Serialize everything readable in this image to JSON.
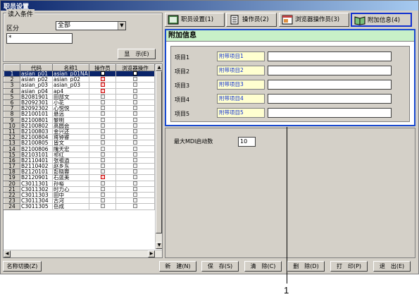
{
  "window": {
    "title": "职员设置"
  },
  "filter": {
    "legend": "读入条件",
    "kubun_label": "区分",
    "kubun_value": "全部",
    "search_value": "*",
    "display_button": "显　示(E)"
  },
  "grid": {
    "headers": [
      "代码",
      "名称1",
      "操作员",
      "浏览器操作"
    ],
    "rows": [
      {
        "n": "1",
        "code": "asian_p01",
        "name": "asian_p01NA",
        "op": "on",
        "br": "on"
      },
      {
        "n": "2",
        "code": "asian_p02",
        "name": "asian_p02",
        "op": "red",
        "br": "off"
      },
      {
        "n": "3",
        "code": "asian_p03",
        "name": "asian_p03",
        "op": "red",
        "br": "off"
      },
      {
        "n": "4",
        "code": "asian_p04",
        "name": "ap4",
        "op": "red",
        "br": "off"
      },
      {
        "n": "5",
        "code": "B2081901",
        "name": "田部文",
        "op": "off",
        "br": "off"
      },
      {
        "n": "6",
        "code": "B2092301",
        "name": "小花",
        "op": "off",
        "br": "off"
      },
      {
        "n": "7",
        "code": "B2092302",
        "name": "心悦悦",
        "op": "off",
        "br": "off"
      },
      {
        "n": "8",
        "code": "B2100101",
        "name": "悬远",
        "op": "off",
        "br": "off"
      },
      {
        "n": "9",
        "code": "B2100801",
        "name": "黎明",
        "op": "off",
        "br": "off"
      },
      {
        "n": "10",
        "code": "B2100802",
        "name": "高圆会",
        "op": "off",
        "br": "off"
      },
      {
        "n": "11",
        "code": "B2100803",
        "name": "金兴还",
        "op": "off",
        "br": "off"
      },
      {
        "n": "12",
        "code": "B2100804",
        "name": "蒋钟睿",
        "op": "off",
        "br": "off"
      },
      {
        "n": "13",
        "code": "B2100805",
        "name": "皆文",
        "op": "off",
        "br": "off"
      },
      {
        "n": "14",
        "code": "B2100806",
        "name": "隗天宏",
        "op": "off",
        "br": "off"
      },
      {
        "n": "15",
        "code": "B2103101",
        "name": "祁红",
        "op": "off",
        "br": "off"
      },
      {
        "n": "16",
        "code": "B2110401",
        "name": "张祖逍",
        "op": "off",
        "br": "off"
      },
      {
        "n": "17",
        "code": "B2110402",
        "name": "赵乡东",
        "op": "off",
        "br": "off"
      },
      {
        "n": "18",
        "code": "B2120101",
        "name": "彭晓蓉",
        "op": "off",
        "br": "off"
      },
      {
        "n": "19",
        "code": "B2120901",
        "name": "石蓝美",
        "op": "red",
        "br": "off"
      },
      {
        "n": "20",
        "code": "C3011301",
        "name": "孙裕",
        "op": "off",
        "br": "off"
      },
      {
        "n": "21",
        "code": "C3011302",
        "name": "时力心",
        "op": "off",
        "br": "off"
      },
      {
        "n": "22",
        "code": "C3011303",
        "name": "田中",
        "op": "off",
        "br": "off"
      },
      {
        "n": "23",
        "code": "C3011304",
        "name": "古河",
        "op": "off",
        "br": "off"
      },
      {
        "n": "24",
        "code": "C3011305",
        "name": "岳成",
        "op": "off",
        "br": "off"
      }
    ]
  },
  "tabs": [
    {
      "label": "职员设置(1)",
      "icon": "ledger-icon"
    },
    {
      "label": "操作员(2)",
      "icon": "document-icon"
    },
    {
      "label": "浏览器操作员(3)",
      "icon": "browser-icon"
    },
    {
      "label": "附加信息(4)",
      "icon": "book-icon"
    }
  ],
  "extra": {
    "heading": "附加信息",
    "items": [
      {
        "label": "项目1",
        "name": "附带项目1",
        "value": ""
      },
      {
        "label": "项目2",
        "name": "附带项目2",
        "value": ""
      },
      {
        "label": "项目3",
        "name": "附带项目3",
        "value": ""
      },
      {
        "label": "项目4",
        "name": "附带项目4",
        "value": ""
      },
      {
        "label": "项目5",
        "name": "附带项目5",
        "value": ""
      }
    ]
  },
  "max_mdi": {
    "label": "最大MDI启动数",
    "value": "10"
  },
  "bottom": {
    "name_switch": "名称切换(Z)",
    "new": "新　建(N)",
    "save": "保　存(S)",
    "clear": "清　除(C)",
    "delete": "删　除(D)",
    "print": "打　印(P)",
    "exit": "退　出(E)"
  },
  "callout": "1",
  "colors": {
    "accent": "#1a4ad0",
    "title_bar": "#0a246a",
    "panel_head": "#c8f0c8"
  }
}
